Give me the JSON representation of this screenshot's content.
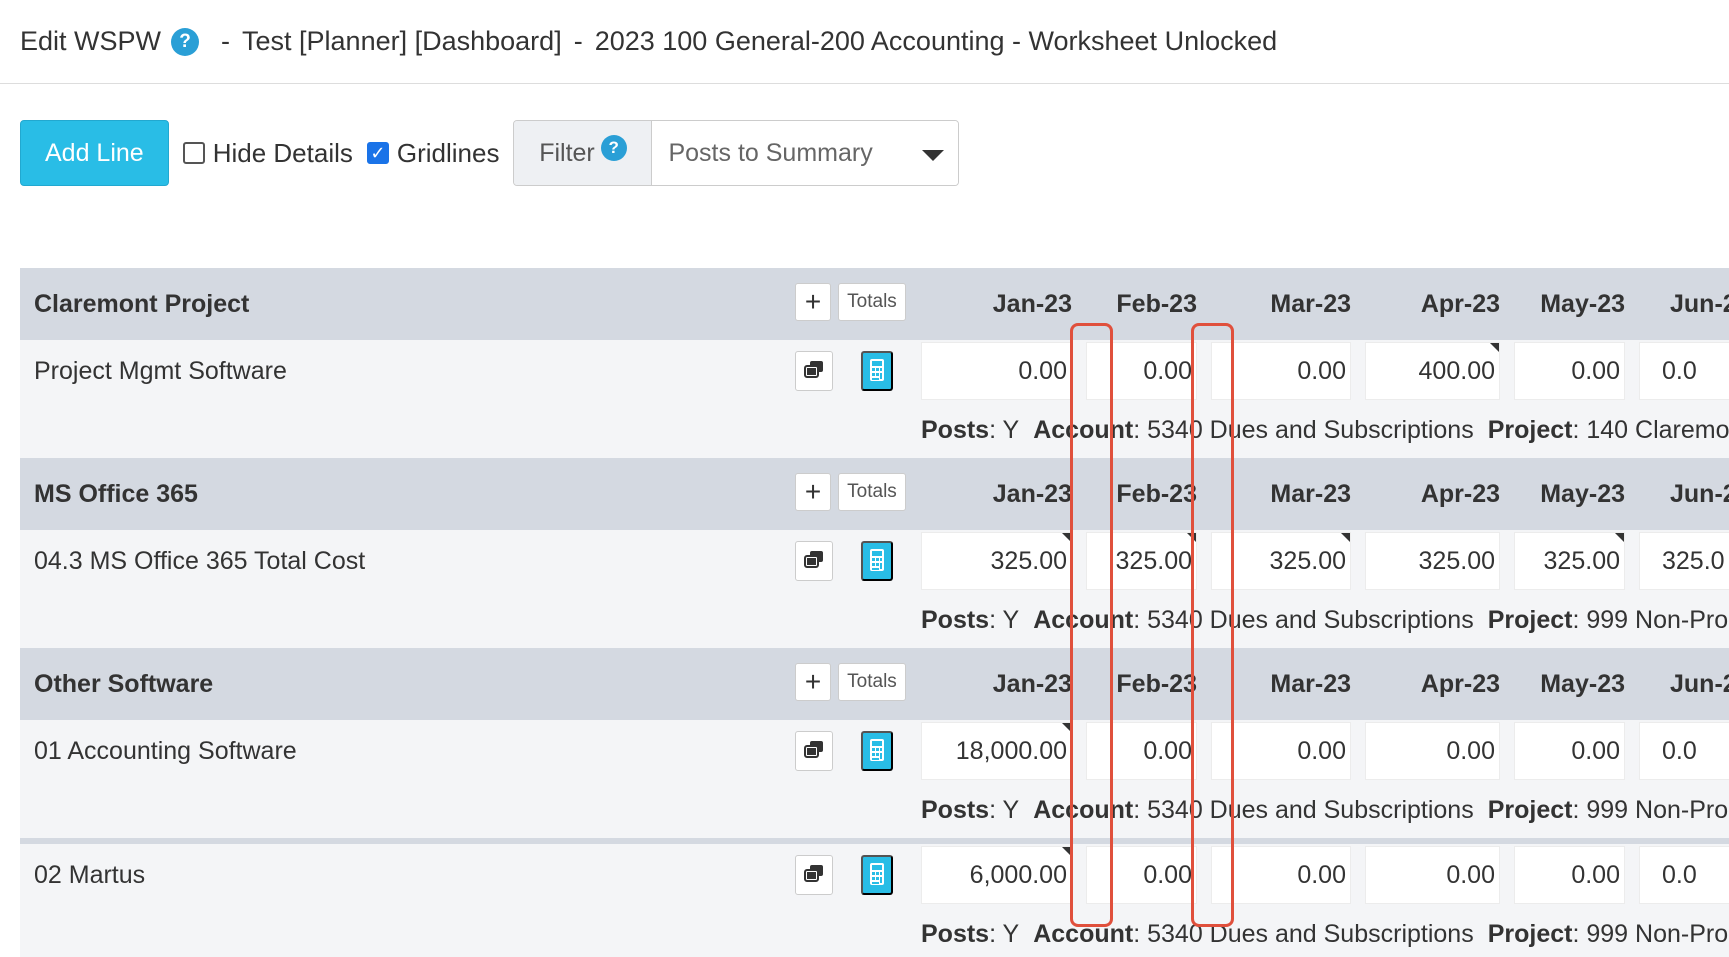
{
  "title": {
    "prefix": "Edit WSPW",
    "help": "?",
    "sep": "-",
    "part1": "Test [Planner] [Dashboard]",
    "part2": "2023 100 General-200 Accounting - Worksheet Unlocked"
  },
  "toolbar": {
    "add_line": "Add Line",
    "hide_details": "Hide Details",
    "hide_details_checked": false,
    "gridlines": "Gridlines",
    "gridlines_checked": true,
    "filter_label": "Filter",
    "filter_help": "?",
    "filter_value": "Posts to Summary"
  },
  "months": [
    "Jan-23",
    "Feb-23",
    "Mar-23",
    "Apr-23",
    "May-23",
    "Jun-2"
  ],
  "totals_label": "Totals",
  "plus_label": "+",
  "groups": [
    {
      "name": "Claremont Project",
      "rows": [
        {
          "label": "Project Mgmt Software",
          "values": [
            "0.00",
            "0.00",
            "0.00",
            "400.00",
            "0.00",
            "0.0"
          ],
          "details": {
            "posts_k": "Posts",
            "posts_v": ": Y",
            "account_k": "Account",
            "account_v": ": 5340 Dues and Subscriptions",
            "project_k": "Project",
            "project_v": ": 140 Claremo"
          }
        }
      ]
    },
    {
      "name": "MS Office 365",
      "rows": [
        {
          "label": "04.3 MS Office 365 Total Cost",
          "values": [
            "325.00",
            "325.00",
            "325.00",
            "325.00",
            "325.00",
            "325.0"
          ],
          "details": {
            "posts_k": "Posts",
            "posts_v": ": Y",
            "account_k": "Account",
            "account_v": ": 5340 Dues and Subscriptions",
            "project_k": "Project",
            "project_v": ": 999 Non-Pro"
          }
        }
      ]
    },
    {
      "name": "Other Software",
      "rows": [
        {
          "label": "01 Accounting Software",
          "values": [
            "18,000.00",
            "0.00",
            "0.00",
            "0.00",
            "0.00",
            "0.0"
          ],
          "details": {
            "posts_k": "Posts",
            "posts_v": ": Y",
            "account_k": "Account",
            "account_v": ": 5340 Dues and Subscriptions",
            "project_k": "Project",
            "project_v": ": 999 Non-Pro"
          }
        },
        {
          "label": "02 Martus",
          "values": [
            "6,000.00",
            "0.00",
            "0.00",
            "0.00",
            "0.00",
            "0.0"
          ],
          "details": {
            "posts_k": "Posts",
            "posts_v": ": Y",
            "account_k": "Account",
            "account_v": ": 5340 Dues and Subscriptions",
            "project_k": "Project",
            "project_v": ": 999 Non-Pro"
          }
        }
      ]
    }
  ],
  "colors": {
    "accent": "#29bde6",
    "header_bg": "#d4d9e1",
    "highlight": "#e0503c"
  }
}
